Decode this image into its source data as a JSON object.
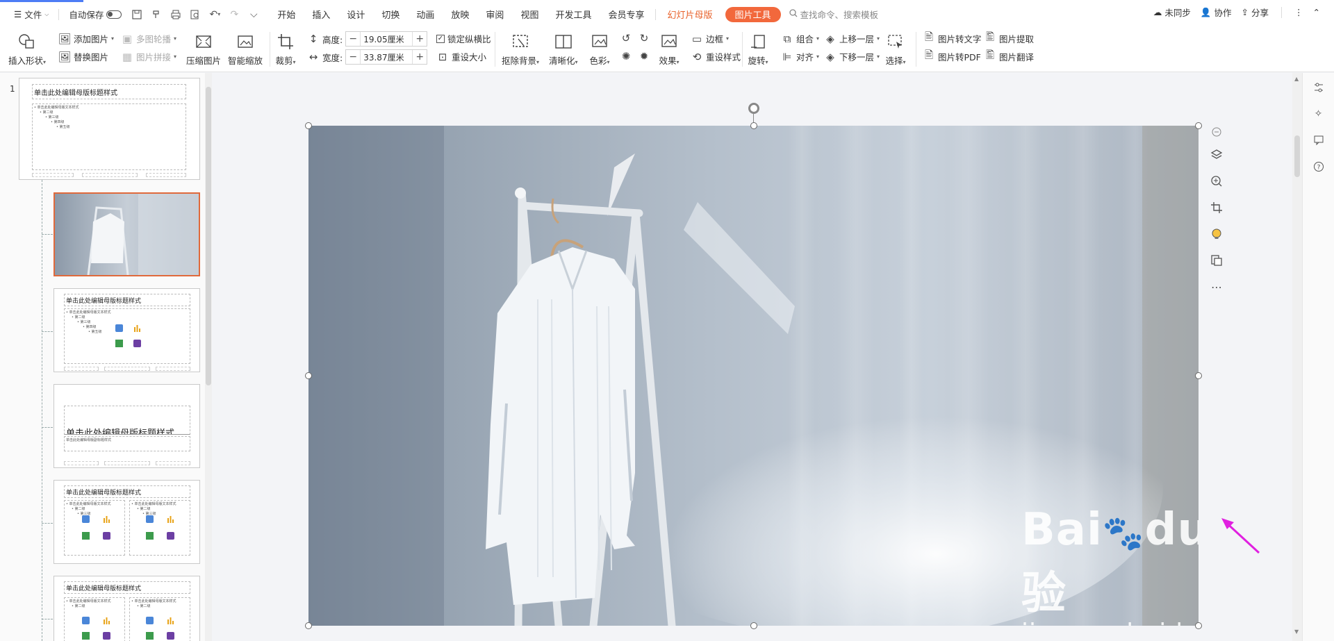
{
  "menubar": {
    "file_label": "文件",
    "autosave_label": "自动保存",
    "tabs": [
      "开始",
      "插入",
      "设计",
      "切换",
      "动画",
      "放映",
      "审阅",
      "视图",
      "开发工具",
      "会员专享"
    ],
    "slide_master_tab": "幻灯片母版",
    "picture_tools_tab": "图片工具",
    "search_placeholder": "查找命令、搜索模板",
    "right": {
      "sync": "未同步",
      "collab": "协作",
      "share": "分享"
    }
  },
  "ribbon": {
    "insert_shape": "插入形状",
    "add_picture": "添加图片",
    "replace_picture": "替换图片",
    "multi_carousel": "多图轮播",
    "picture_collage": "图片拼接",
    "compress_picture": "压缩图片",
    "smart_zoom": "智能缩放",
    "crop": "裁剪",
    "height_label": "高度:",
    "height_value": "19.05厘米",
    "width_label": "宽度:",
    "width_value": "33.87厘米",
    "lock_ratio": "锁定纵横比",
    "reset_size": "重设大小",
    "remove_background": "抠除背景",
    "sharpen": "清晰化",
    "color": "色彩",
    "effects": "效果",
    "border": "边框",
    "reset_style": "重设样式",
    "rotate": "旋转",
    "group": "组合",
    "align": "对齐",
    "bring_forward": "上移一层",
    "send_backward": "下移一层",
    "select": "选择",
    "pic_to_text": "图片转文字",
    "pic_to_pdf": "图片转PDF",
    "pic_extract": "图片提取",
    "pic_translate": "图片翻译"
  },
  "thumbnails": {
    "slide_number": "1",
    "master_title": "单击此处编辑母版标题样式",
    "master_body": [
      "• 单击此处编辑母版文本样式",
      "• 第二级",
      "• 第三级",
      "• 第四级",
      "• 第五级"
    ],
    "layout_title": "单击此处编辑母版标题样式",
    "layout_subtitle": "单击此处编辑母版副标题样式"
  },
  "watermark": {
    "brand": "Bai",
    "brand_mid": "du",
    "brand_cn": "经验",
    "url": "jingyan.baidu.com"
  },
  "colors": {
    "accent_orange": "#f2683c",
    "selection_border": "#e0693b",
    "annotation_arrow": "#e020e0"
  }
}
